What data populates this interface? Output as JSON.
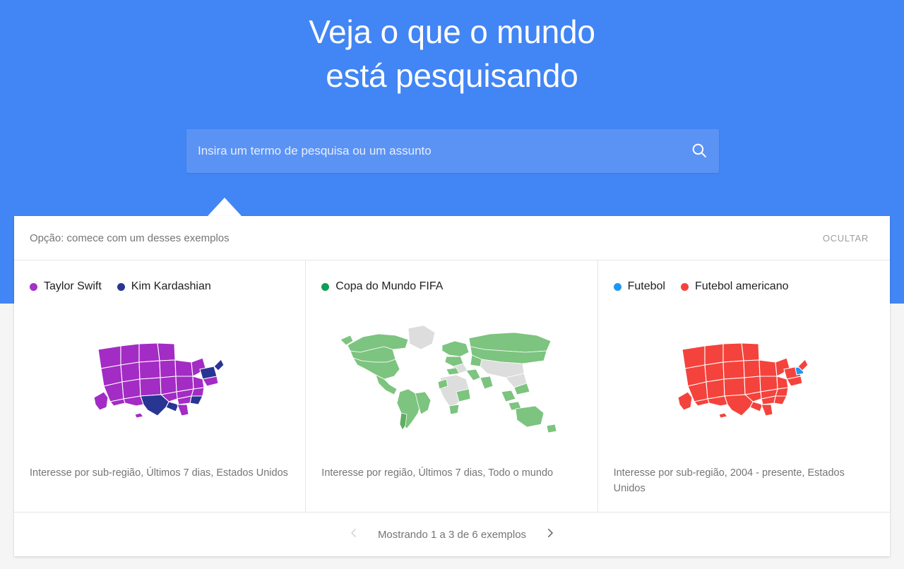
{
  "hero": {
    "title": "Veja o que o mundo\nestá pesquisando",
    "background_color": "#4285f4"
  },
  "search": {
    "placeholder": "Insira um termo de pesquisa ou um assunto",
    "value": "",
    "icon": "search-icon",
    "field_color": "#5b93f5"
  },
  "panel": {
    "header_title": "Opção: comece com um desses exemplos",
    "hide_label": "OCULTAR",
    "examples": [
      {
        "legend": [
          {
            "label": "Taylor Swift",
            "color": "#a332c6"
          },
          {
            "label": "Kim Kardashian",
            "color": "#283593"
          }
        ],
        "map_type": "us-states",
        "caption": "Interesse por sub-região, Últimos 7 dias, Estados Unidos"
      },
      {
        "legend": [
          {
            "label": "Copa do Mundo FIFA",
            "color": "#0f9d58"
          }
        ],
        "map_type": "world",
        "caption": "Interesse por região, Últimos 7 dias, Todo o mundo"
      },
      {
        "legend": [
          {
            "label": "Futebol",
            "color": "#2196f3"
          },
          {
            "label": "Futebol americano",
            "color": "#f4433c"
          }
        ],
        "map_type": "us-states",
        "caption": "Interesse por sub-região, 2004 - presente, Estados Unidos"
      }
    ],
    "pagination": {
      "text": "Mostrando 1 a 3 de 6 exemplos",
      "prev_icon": "chevron-left-icon",
      "next_icon": "chevron-right-icon",
      "prev_enabled": false,
      "next_enabled": true
    }
  },
  "map_colors": {
    "card1_primary": "#a32cc4",
    "card1_secondary": "#2b3a8f",
    "card2_primary": "#7cc47f",
    "card2_nodata": "#dddddd",
    "card3_primary": "#f4433c",
    "card3_secondary": "#2196f3",
    "state_border": "#ffffff"
  }
}
